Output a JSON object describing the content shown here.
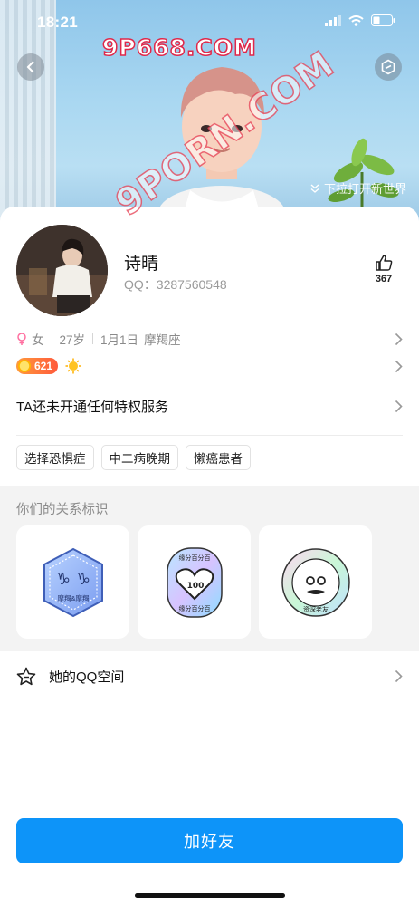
{
  "status_bar": {
    "time": "18:21"
  },
  "watermarks": {
    "top": "9P668.COM",
    "diagonal": "9PORN.COM"
  },
  "banner": {
    "pull_hint": "下拉打开新世界"
  },
  "profile": {
    "name": "诗晴",
    "qq": "QQ：3287560548",
    "likes": "367",
    "gender": "女",
    "age": "27岁",
    "birthday": "1月1日",
    "zodiac": "摩羯座",
    "level": "621"
  },
  "service": {
    "label": "TA还未开通任何特权服务"
  },
  "tags": [
    "选择恐惧症",
    "中二病晚期",
    "懒癌患者"
  ],
  "relation": {
    "title": "你们的关系标识",
    "badges": [
      {
        "icon": "capricorn-badge-icon",
        "text": "摩羯&摩羯"
      },
      {
        "icon": "heart-100-badge-icon",
        "text_top": "缘分百分百",
        "text_bottom": "缘分百分百"
      },
      {
        "icon": "face-badge-icon",
        "text": "资深老友"
      }
    ]
  },
  "qzone": {
    "label": "她的QQ空间"
  },
  "actions": {
    "add_friend": "加好友"
  },
  "colors": {
    "primary": "#0d94f9",
    "level_badge": "#ff6a3c",
    "female": "#ff6fa0"
  }
}
